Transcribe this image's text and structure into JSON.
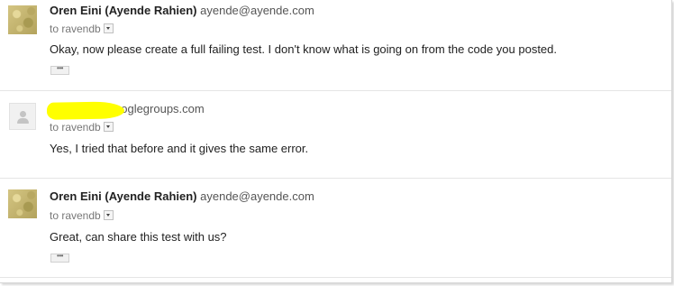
{
  "messages": [
    {
      "sender_name": "Oren Eini (Ayende Rahien)",
      "sender_email": "ayende@ayende.com",
      "recipient": "to ravendb",
      "body": "Okay, now please create a full failing test. I don't know what is going on from the code you posted.",
      "has_quote_toggle": true,
      "avatar": "photo"
    },
    {
      "sender_name": "",
      "sender_email": "ooglegroups.com",
      "recipient": "to ravendb",
      "body": "Yes, I tried that before and it gives the same error.",
      "has_quote_toggle": false,
      "avatar": "default-person-icon"
    },
    {
      "sender_name": "Oren Eini (Ayende Rahien)",
      "sender_email": "ayende@ayende.com",
      "recipient": "to ravendb",
      "body": "Great, can share this test with us?",
      "has_quote_toggle": true,
      "avatar": "photo"
    }
  ],
  "quote_toggle_label": "•••",
  "highlight_color": "#ffff00"
}
